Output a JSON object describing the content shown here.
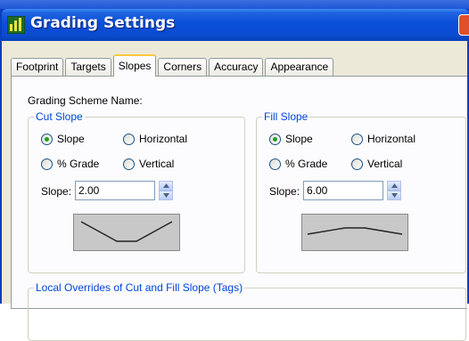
{
  "window": {
    "title": "Grading Settings",
    "icon": "grading-app-icon"
  },
  "tabs": [
    {
      "label": "Footprint",
      "active": false
    },
    {
      "label": "Targets",
      "active": false
    },
    {
      "label": "Slopes",
      "active": true
    },
    {
      "label": "Corners",
      "active": false
    },
    {
      "label": "Accuracy",
      "active": false
    },
    {
      "label": "Appearance",
      "active": false
    }
  ],
  "panel": {
    "scheme_label": "Grading Scheme Name:",
    "cut": {
      "legend": "Cut Slope",
      "options": [
        {
          "label": "Slope",
          "checked": true
        },
        {
          "label": "Horizontal",
          "checked": false
        },
        {
          "label": "% Grade",
          "checked": false
        },
        {
          "label": "Vertical",
          "checked": false
        }
      ],
      "slope_label": "Slope:",
      "slope_value": "2.00",
      "preview_icon": "cut-slope-profile-icon"
    },
    "fill": {
      "legend": "Fill Slope",
      "options": [
        {
          "label": "Slope",
          "checked": true
        },
        {
          "label": "Horizontal",
          "checked": false
        },
        {
          "label": "% Grade",
          "checked": false
        },
        {
          "label": "Vertical",
          "checked": false
        }
      ],
      "slope_label": "Slope:",
      "slope_value": "6.00",
      "preview_icon": "fill-slope-profile-icon"
    },
    "overrides": {
      "legend": "Local Overrides of Cut and Fill Slope (Tags)"
    }
  },
  "colors": {
    "titlebar": "#0a4fd9",
    "dialog_bg": "#ece9d8",
    "legend_text": "#0046d5",
    "radio_dot": "#21a121",
    "active_tab_accent": "#ffc83c"
  }
}
